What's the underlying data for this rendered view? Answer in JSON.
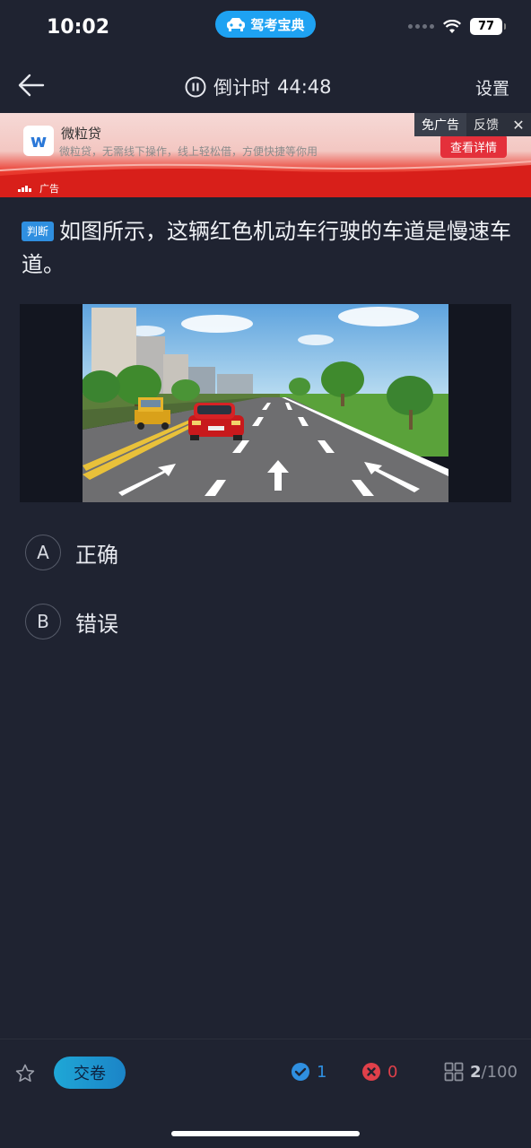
{
  "status": {
    "time": "10:02",
    "app_name": "驾考宝典",
    "battery": "77"
  },
  "nav": {
    "timer_label": "倒计时",
    "timer_value": "44:48",
    "settings_label": "设置"
  },
  "ad": {
    "brand": "微粒贷",
    "logo_letter": "w",
    "description": "微粒贷，无需线下操作，线上轻松借，方便快捷等你用",
    "cta": "查看详情",
    "free_ad": "免广告",
    "feedback": "反馈",
    "close": "✕",
    "ad_mark": "广告"
  },
  "question": {
    "type_badge": "判断",
    "text": "如图所示，这辆红色机动车行驶的车道是慢速车道。"
  },
  "options": [
    {
      "letter": "A",
      "text": "正确"
    },
    {
      "letter": "B",
      "text": "错误"
    }
  ],
  "bottom": {
    "submit_label": "交卷",
    "correct_count": "1",
    "wrong_count": "0",
    "current_index": "2",
    "total": "/100"
  },
  "colors": {
    "background": "#1f2331",
    "accent_blue": "#2f8fe0",
    "error_red": "#e0404a",
    "ad_red": "#e4303b"
  },
  "icons": {
    "back": "arrow-left-icon",
    "pause": "pause-circle-icon",
    "star": "star-outline-icon",
    "correct": "check-circle-icon",
    "wrong": "x-circle-icon",
    "grid": "grid-icon"
  }
}
